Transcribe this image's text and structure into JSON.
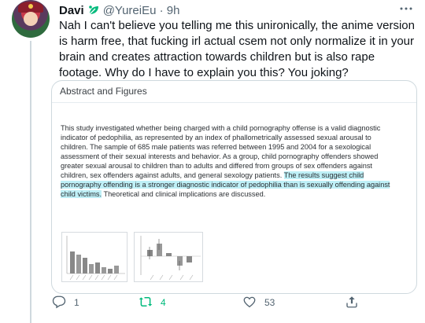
{
  "author": {
    "name": "Davi",
    "handle": "@YureiEu",
    "separator": "·",
    "time": "9h"
  },
  "tweet": {
    "text": "Nah I can't believe you telling me this unironically, the anime version is harm free, that fucking irl actual csem not only normalize it in your brain and creates attraction towards children but is also rape footage. Why do I have to explain you this? You joking?"
  },
  "card": {
    "heading": "Abstract and Figures",
    "abstract_plain": "This study investigated whether being charged with a child pornography offense is a valid diagnostic indicator of pedophilia, as represented by an index of phallometrically assessed sexual arousal to children. The sample of 685 male patients was referred between 1995 and 2004 for a sexological assessment of their sexual interests and behavior. As a group, child pornography offenders showed greater sexual arousal to children than to adults and differed from groups of sex offenders against children, sex offenders against adults, and general sexology patients. ",
    "abstract_highlight": "The results suggest child pornography offending is a stronger diagnostic indicator of pedophilia than is sexually offending against child victims.",
    "abstract_tail": " Theoretical and clinical implications are discussed."
  },
  "actions": {
    "reply_count": "1",
    "retweet_count": "4",
    "like_count": "53"
  },
  "colors": {
    "retweet": "#00ba7c",
    "muted": "#536471",
    "highlight": "#bff0f7",
    "badge": "#00ba7c"
  },
  "icons": [
    "leaf-badge-icon",
    "more-icon",
    "reply-icon",
    "retweet-icon",
    "like-icon",
    "share-icon"
  ]
}
